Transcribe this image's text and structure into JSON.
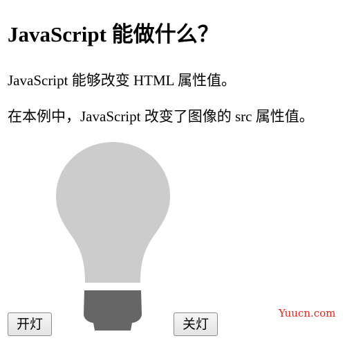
{
  "heading": "JavaScript 能做什么？",
  "paragraphs": [
    "JavaScript 能够改变 HTML 属性值。",
    "在本例中，JavaScript 改变了图像的 src 属性值。"
  ],
  "buttons": {
    "on_label": "开灯",
    "off_label": "关灯"
  },
  "bulb": {
    "state": "off",
    "glass_color": "#cccccc",
    "base_color": "#666666",
    "icon": "lightbulb-off-icon"
  },
  "watermark": "Yuucn.com"
}
